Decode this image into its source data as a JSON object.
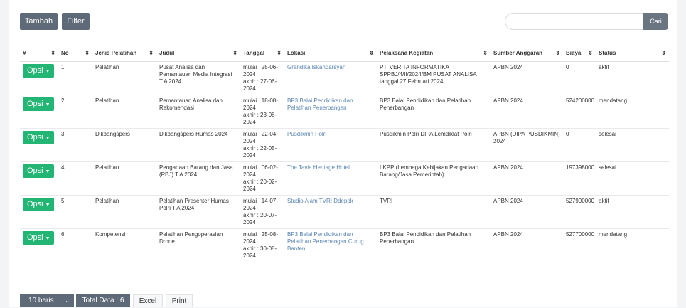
{
  "toolbar": {
    "add_label": "Tambah",
    "filter_label": "Filter"
  },
  "search": {
    "placeholder": "",
    "value": "",
    "button_label": "Cari"
  },
  "table": {
    "headers": [
      "#",
      "No",
      "Jenis Pelatihan",
      "Judul",
      "Tanggal",
      "Lokasi",
      "Pelaksana Kegiatan",
      "Sumber Anggaran",
      "Biaya",
      "Status"
    ],
    "action_label": "Opsi",
    "rows": [
      {
        "no": "1",
        "jenis": "Pelatihan",
        "judul": "Pusat Analisa dan Pemantauan Media Integrasi T.A 2024",
        "tanggal": [
          "mulai : 25-06-",
          "2024",
          "akhir : 27-06-",
          "2024"
        ],
        "lokasi": "Grandika Iskandarsyah",
        "pelaksana": "PT. VERITA INFORMATIKA SPPBJ/4/II/2024/BM PUSAT ANALISA tanggal 27 Februari 2024",
        "sumber": "APBN 2024",
        "biaya": "0",
        "status": "aktif"
      },
      {
        "no": "2",
        "jenis": "Pelatihan",
        "judul": "Pemantauan Analisa dan Rekomendasi",
        "tanggal": [
          "mulai : 18-08-",
          "2024",
          "akhir : 23-08-",
          "2024"
        ],
        "lokasi": "BP3 Balai Pendidikan dan Pelatihan Penerbangan",
        "pelaksana": "BP3 Balai Pendidikan dan Pelatihan Penerbangan",
        "sumber": "APBN 2024",
        "biaya": "524200000",
        "status": "mendatang"
      },
      {
        "no": "3",
        "jenis": "Dikbangspers",
        "judul": "Dikbangspers Humas 2024",
        "tanggal": [
          "mulai : 22-04-",
          "2024",
          "akhir : 22-05-",
          "2024"
        ],
        "lokasi": "Pusdikmin Polri",
        "pelaksana": "Pusdikmin Polri DIPA Lemdiklat Polri",
        "sumber": "APBN (DIPA PUSDIKMIN) 2024",
        "biaya": "0",
        "status": "selesai"
      },
      {
        "no": "4",
        "jenis": "Pelatihan",
        "judul": "Pengadaan Barang dan Jasa (PBJ) T.A 2024",
        "tanggal": [
          "mulai : 06-02-",
          "2024",
          "akhir : 20-02-",
          "2024"
        ],
        "lokasi": "The Tavia Heritage Hotel",
        "pelaksana": "LKPP (Lembaga Kebijakan Pengadaan Barang/Jasa Pemerintah)",
        "sumber": "APBN 2024",
        "biaya": "197398000",
        "status": "selesai"
      },
      {
        "no": "5",
        "jenis": "Pelatihan",
        "judul": "Pelatihan Presenter Humas Polri T.A 2024",
        "tanggal": [
          "mulai : 14-07-",
          "2024",
          "akhir : 20-07-",
          "2024"
        ],
        "lokasi": "Studio Alam TVRI Ddepok",
        "pelaksana": "TVRI",
        "sumber": "APBN 2024",
        "biaya": "527900000",
        "status": "aktif"
      },
      {
        "no": "6",
        "jenis": "Kompetensi",
        "judul": "Pelatihan Pengoperasian Drone",
        "tanggal": [
          "mulai : 25-08-",
          "2024",
          "akhir : 30-08-",
          "2024"
        ],
        "lokasi": "BP3 Balai Pendidikan dan Pelatihan Penerbangan Curug Banten",
        "pelaksana": "BP3 Balai Pendidikan dan Pelatihan Penerbangan",
        "sumber": "APBN 2024",
        "biaya": "527700000",
        "status": "mendatang"
      }
    ]
  },
  "footer": {
    "page_size": "10 baris",
    "total": "Total Data : 6",
    "excel": "Excel",
    "print": "Print"
  },
  "icons": {
    "sort": "sort-icon",
    "caret": "caret-down-icon"
  },
  "colors": {
    "primary_dark": "#5f6a78",
    "success": "#22b573",
    "link": "#5b86b4"
  }
}
